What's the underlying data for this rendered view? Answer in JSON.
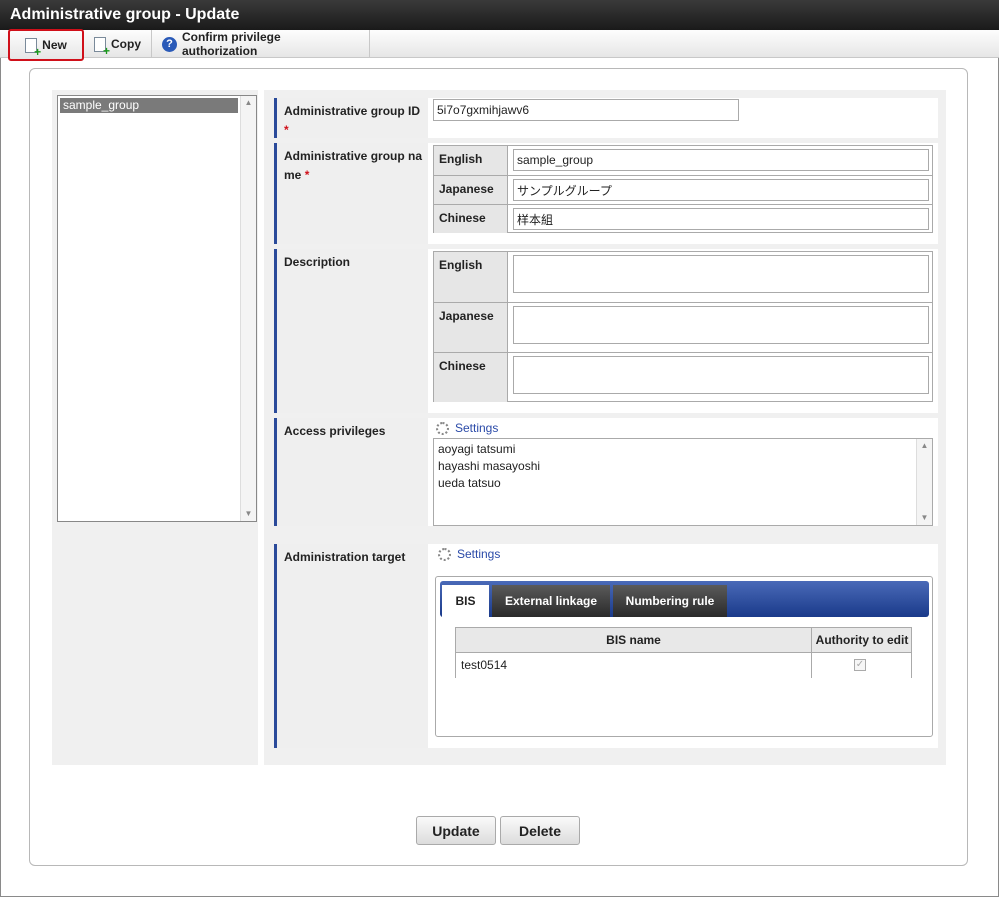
{
  "window": {
    "title": "Administrative group - Update"
  },
  "toolbar": {
    "new_label": "New",
    "copy_label": "Copy",
    "confirm_label": "Confirm privilege authorization"
  },
  "group_list": {
    "items": [
      "sample_group"
    ]
  },
  "form": {
    "group_id": {
      "label": "Administrative group ID",
      "required_mark": "*",
      "value": "5i7o7gxmihjawv6"
    },
    "group_name": {
      "label_line1": "Administrative group na",
      "label_line2": "me",
      "required_mark": "*",
      "english_label": "English",
      "english_value": "sample_group",
      "japanese_label": "Japanese",
      "japanese_value": "サンプルグループ",
      "chinese_label": "Chinese",
      "chinese_value": "样本組"
    },
    "description": {
      "label": "Description",
      "english_label": "English",
      "english_value": "",
      "japanese_label": "Japanese",
      "japanese_value": "",
      "chinese_label": "Chinese",
      "chinese_value": ""
    },
    "access_privileges": {
      "label": "Access privileges",
      "settings_label": "Settings",
      "users": [
        "aoyagi tatsumi",
        "hayashi masayoshi",
        "ueda tatsuo"
      ]
    },
    "administration_target": {
      "label": "Administration target",
      "settings_label": "Settings",
      "tabs": [
        "BIS",
        "External linkage",
        "Numbering rule"
      ],
      "active_tab": "BIS",
      "table": {
        "headers": [
          "BIS name",
          "Authority to edit"
        ],
        "rows": [
          {
            "bis_name": "test0514",
            "authority_to_edit": true
          }
        ]
      }
    }
  },
  "actions": {
    "update_label": "Update",
    "delete_label": "Delete"
  },
  "colors": {
    "accent": "#2a4a9a",
    "highlight": "#d0101a",
    "link": "#2a4aa8"
  }
}
